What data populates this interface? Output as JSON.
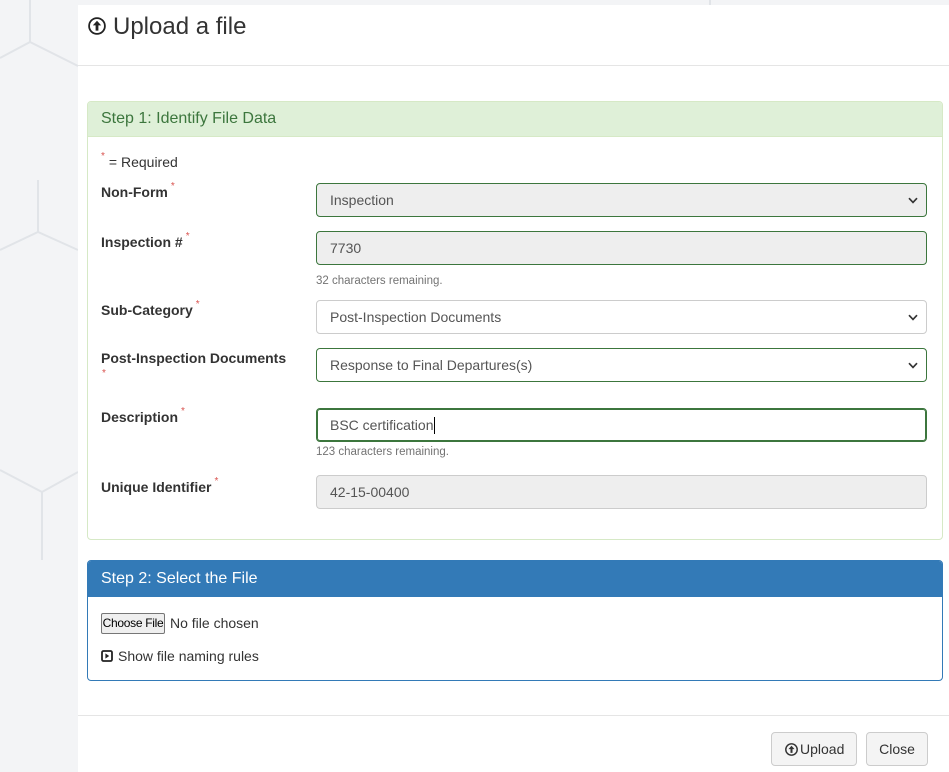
{
  "modal": {
    "title": "Upload a file",
    "title_icon": "circle-arrow-up-icon"
  },
  "step1": {
    "heading": "Step 1: Identify File Data",
    "required_marker": "*",
    "required_note": "= Required",
    "non_form": {
      "label": "Non-Form",
      "value": "Inspection"
    },
    "inspection_number": {
      "label": "Inspection #",
      "value": "7730",
      "help": "32 characters remaining."
    },
    "sub_category": {
      "label": "Sub-Category",
      "value": "Post-Inspection Documents"
    },
    "post_inspection_documents": {
      "label": "Post-Inspection Documents",
      "value": "Response to Final Departures(s)"
    },
    "description": {
      "label": "Description",
      "value": "BSC certification",
      "help": "123 characters remaining."
    },
    "unique_identifier": {
      "label": "Unique Identifier",
      "value": "42-15-00400"
    }
  },
  "step2": {
    "heading": "Step 2: Select the File",
    "choose_file_label": "Choose File",
    "file_status": "No file chosen",
    "naming_rules_label": "Show file naming rules",
    "naming_rules_icon": "expand-icon"
  },
  "footer": {
    "upload_label": "Upload",
    "upload_icon": "circle-arrow-up-icon",
    "close_label": "Close"
  },
  "colors": {
    "success_text": "#3c763d",
    "success_bg": "#dff0d8",
    "success_border": "#d6e9c6",
    "primary": "#337ab7",
    "required": "#d9534f",
    "disabled_bg": "#eeeeee"
  }
}
